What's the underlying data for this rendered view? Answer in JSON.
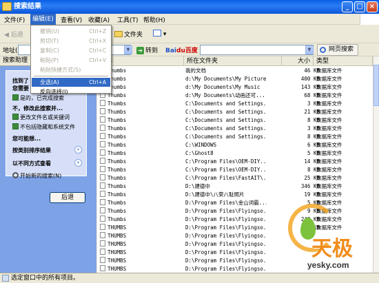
{
  "window": {
    "title": "搜索结果"
  },
  "menubar": {
    "items": [
      "文件(F)",
      "编辑(E)",
      "查看(V)",
      "收藏(A)",
      "工具(T)",
      "帮助(H)"
    ]
  },
  "toolbar": {
    "back": "后退",
    "folders": "文件夹"
  },
  "addressbar": {
    "label": "地址(D)",
    "go": "转到",
    "baidu_bai": "Bai",
    "baidu_du": "du",
    "baidu_suffix": "百度",
    "web_search": "网页搜索"
  },
  "edit_menu": {
    "items": [
      {
        "label": "撤销(U)",
        "shortcut": "Ctrl+Z",
        "disabled": true
      },
      {
        "label": "剪切(T)",
        "shortcut": "Ctrl+X",
        "disabled": true
      },
      {
        "label": "复制(C)",
        "shortcut": "Ctrl+C",
        "disabled": true
      },
      {
        "label": "粘贴(P)",
        "shortcut": "Ctrl+V",
        "disabled": true
      },
      {
        "label": "粘贴快捷方式(S)",
        "shortcut": "",
        "disabled": true
      },
      {
        "label": "全选(A)",
        "shortcut": "Ctrl+A",
        "selected": true
      },
      {
        "label": "反向选择(I)",
        "shortcut": ""
      }
    ]
  },
  "left_pane": {
    "header": "搜索助理",
    "close": "×",
    "found_1": "找到了",
    "found_2": "您需要",
    "option_yes": "是的，已完成搜索",
    "refine_title": "不，修改此搜索并...",
    "refine_1": "更改文件名或关键词",
    "refine_2": "不包括隐藏和系统文件",
    "want_title": "您可能想...",
    "sort_by": "按类别排序结果",
    "view_by": "以不同方式查看",
    "new_search": "开始新的搜索(N)",
    "back_button": "后退"
  },
  "list": {
    "columns": [
      "名称",
      "所在文件夹",
      "大小",
      "类型"
    ],
    "rows": [
      {
        "name": "Thumbs",
        "folder": "我的文档",
        "size": "46 KB",
        "type": "数据库文件"
      },
      {
        "name": "Thumbs",
        "folder": "d:\\My Documents\\My Pictures",
        "size": "400 KB",
        "type": "数据库文件"
      },
      {
        "name": "Thumbs",
        "folder": "d:\\My Documents\\My Music",
        "size": "143 KB",
        "type": "数据库文件"
      },
      {
        "name": "Thumbs",
        "folder": "d:\\My Documents\\动画还可...",
        "size": "68 KB",
        "type": "数据库文件"
      },
      {
        "name": "Thumbs",
        "folder": "C:\\Documents and Settings...",
        "size": "3 KB",
        "type": "数据库文件"
      },
      {
        "name": "Thumbs",
        "folder": "C:\\Documents and Settings...",
        "size": "21 KB",
        "type": "数据库文件"
      },
      {
        "name": "Thumbs",
        "folder": "C:\\Documents and Settings...",
        "size": "8 KB",
        "type": "数据库文件"
      },
      {
        "name": "Thumbs",
        "folder": "C:\\Documents and Settings...",
        "size": "3 KB",
        "type": "数据库文件"
      },
      {
        "name": "Thumbs",
        "folder": "C:\\Documents and Settings...",
        "size": "8 KB",
        "type": "数据库文件"
      },
      {
        "name": "Thumbs",
        "folder": "C:\\WINDOWS",
        "size": "6 KB",
        "type": "数据库文件"
      },
      {
        "name": "Thumbs",
        "folder": "C:\\Ghost8",
        "size": "5 KB",
        "type": "数据库文件"
      },
      {
        "name": "Thumbs",
        "folder": "C:\\Program Files\\OEM-DIY...",
        "size": "14 KB",
        "type": "数据库文件"
      },
      {
        "name": "Thumbs",
        "folder": "C:\\Program Files\\OEM-DIY...",
        "size": "8 KB",
        "type": "数据库文件"
      },
      {
        "name": "Thumbs",
        "folder": "C:\\Program Files\\FastAIT\\...",
        "size": "25 KB",
        "type": "数据库文件"
      },
      {
        "name": "Thumbs",
        "folder": "D:\\建德中",
        "size": "346 KB",
        "type": "数据库文件"
      },
      {
        "name": "Thumbs",
        "folder": "D:\\建德中\\八荣八耻照片",
        "size": "19 KB",
        "type": "数据库文件"
      },
      {
        "name": "Thumbs",
        "folder": "D:\\Program Files\\金山词霸...",
        "size": "5 KB",
        "type": "数据库文件"
      },
      {
        "name": "Thumbs",
        "folder": "D:\\Program Files\\Flyingso...",
        "size": "9 KB",
        "type": "数据库文件"
      },
      {
        "name": "Thumbs",
        "folder": "D:\\Program Files\\Flyingso...",
        "size": "248 KB",
        "type": "数据库文件"
      },
      {
        "name": "THUMBS",
        "folder": "D:\\Program Files\\Flyingso...",
        "size": "5 KB",
        "type": "数据库文件"
      },
      {
        "name": "THUMBS",
        "folder": "D:\\Program Files\\Flyingso...",
        "size": "",
        "type": ""
      },
      {
        "name": "THUMBS",
        "folder": "D:\\Program Files\\Flyingso...",
        "size": "",
        "type": ""
      },
      {
        "name": "THUMBS",
        "folder": "D:\\Program Files\\Flyingso...",
        "size": "",
        "type": ""
      },
      {
        "name": "THUMBS",
        "folder": "D:\\Program Files\\Flyingso...",
        "size": "",
        "type": ""
      },
      {
        "name": "THUMBS",
        "folder": "D:\\Program Files\\Flyingso...",
        "size": "",
        "type": ""
      }
    ]
  },
  "statusbar": {
    "text": "选定窗口中的所有项目。"
  },
  "watermark": {
    "brand": "天极",
    "site": "yesky.com"
  },
  "colors": {
    "titlebar": "#0a5fe5",
    "left_pane": "#7ea2e6",
    "selection": "#316ac5"
  }
}
